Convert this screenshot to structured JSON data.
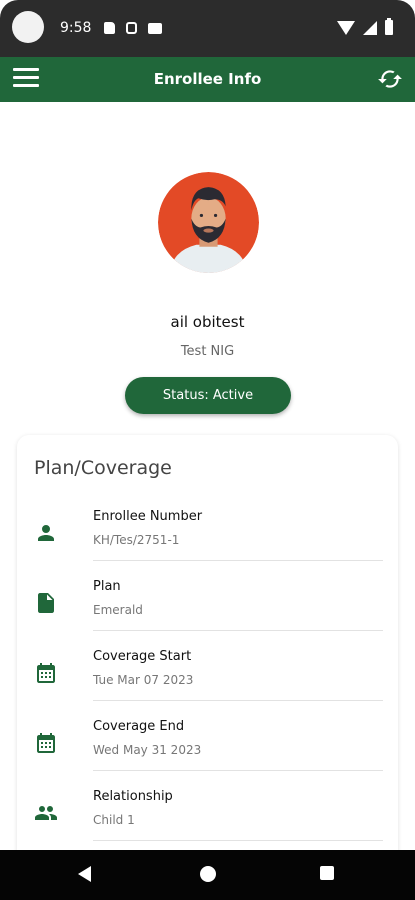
{
  "status_bar": {
    "time": "9:58"
  },
  "app_bar": {
    "title": "Enrollee Info",
    "menu_icon": "hamburger-menu-icon",
    "refresh_icon": "refresh-icon"
  },
  "profile": {
    "name": "ail obitest",
    "organization": "Test NIG",
    "status": "Status: Active",
    "avatar_icon": "person-avatar"
  },
  "plan_card": {
    "title": "Plan/Coverage",
    "items": [
      {
        "label": "Enrollee Number",
        "value": "KH/Tes/2751-1",
        "icon": "person-icon"
      },
      {
        "label": "Plan",
        "value": "Emerald",
        "icon": "document-icon"
      },
      {
        "label": "Coverage Start",
        "value": "Tue Mar 07 2023",
        "icon": "calendar-icon"
      },
      {
        "label": "Coverage End",
        "value": "Wed May 31 2023",
        "icon": "calendar-icon"
      },
      {
        "label": "Relationship",
        "value": "Child 1",
        "icon": "group-icon"
      }
    ]
  },
  "colors": {
    "primary": "#20673a",
    "avatar_bg": "#e34a26"
  }
}
